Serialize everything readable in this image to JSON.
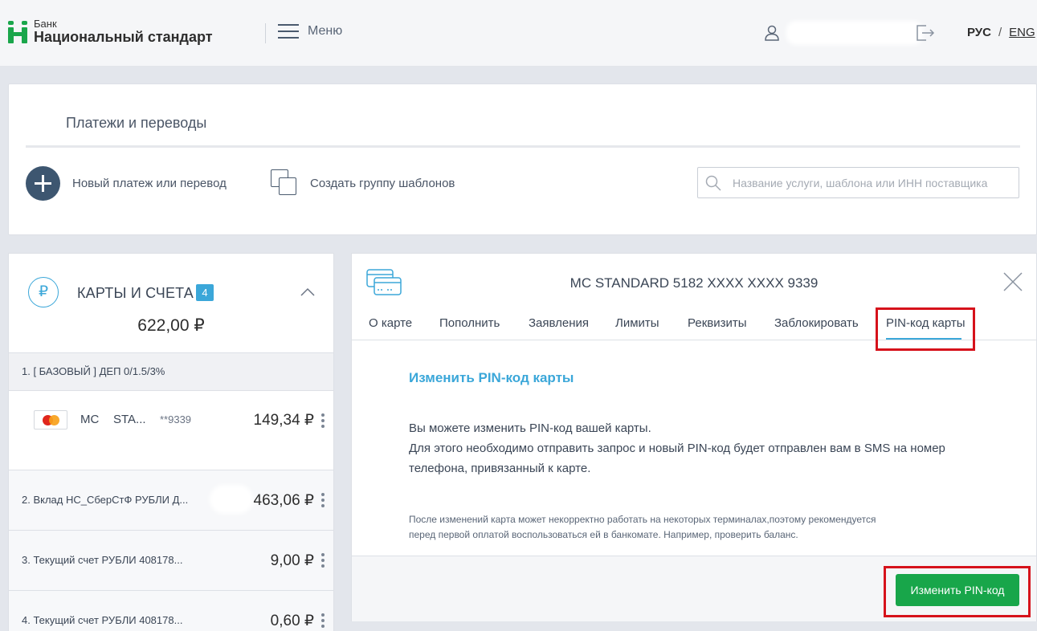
{
  "header": {
    "logo_small": "Банк",
    "logo_big": "Национальный стандарт",
    "menu_label": "Меню",
    "lang_ru": "РУС",
    "lang_sep": "/",
    "lang_en": "ENG"
  },
  "payments": {
    "title": "Платежи и переводы",
    "new_payment": "Новый платеж или перевод",
    "create_group": "Создать группу шаблонов",
    "search_placeholder": "Название услуги, шаблона или ИНН поставщика"
  },
  "cards": {
    "title": "КАРТЫ И СЧЕТА",
    "badge": "4",
    "total_int": "622",
    "total_dec": ",00 ₽",
    "currency_symbol": "₽",
    "group1": "1. [ БАЗОВЫЙ ] ДЕП 0/1.5/3%",
    "card1": {
      "name": "MC",
      "sub": "STA...",
      "mask": "**9339",
      "amount_int": "149",
      "amount_dec": ",34 ₽"
    },
    "accounts": [
      {
        "label": "2. Вклад НС_СберСтФ РУБЛИ Д...",
        "amount_int": "463",
        "amount_dec": ",06 ₽"
      },
      {
        "label": "3. Текущий счет РУБЛИ 408178...",
        "amount_int": "9",
        "amount_dec": ",00 ₽"
      },
      {
        "label": "4. Текущий счет РУБЛИ 408178...",
        "amount_int": "0",
        "amount_dec": ",60 ₽"
      }
    ]
  },
  "detail": {
    "title": "MC STANDARD 5182 XXXX XXXX 9339",
    "tabs": [
      "О карте",
      "Пополнить",
      "Заявления",
      "Лимиты",
      "Реквизиты",
      "Заблокировать",
      "PIN-код карты"
    ],
    "active_tab": "PIN-код карты",
    "pin_title": "Изменить PIN-код карты",
    "pin_line1": "Вы можете изменить PIN-код вашей карты.",
    "pin_line2": "Для этого необходимо отправить запрос и новый PIN-код будет отправлен вам в SMS на номер",
    "pin_line3": "телефона, привязанный к карте.",
    "note_line1": "После изменений карта может некорректно работать на некоторых терминалах,поэтому рекомендуется",
    "note_line2": "перед первой оплатой воспользоваться ей в банкомате. Например, проверить баланс.",
    "change_button": "Изменить PIN-код"
  },
  "colors": {
    "brand_green": "#1aa64b",
    "accent_blue": "#3ba7d9",
    "highlight_red": "#d6121b",
    "button_green": "#18a64a"
  },
  "icons": [
    "user-icon",
    "logout-icon",
    "hamburger-icon",
    "plus-icon",
    "squares-icon",
    "search-icon",
    "ruble-icon",
    "chevron-up-icon",
    "mastercard-icon",
    "kebab-icon",
    "card-icon",
    "close-icon"
  ]
}
